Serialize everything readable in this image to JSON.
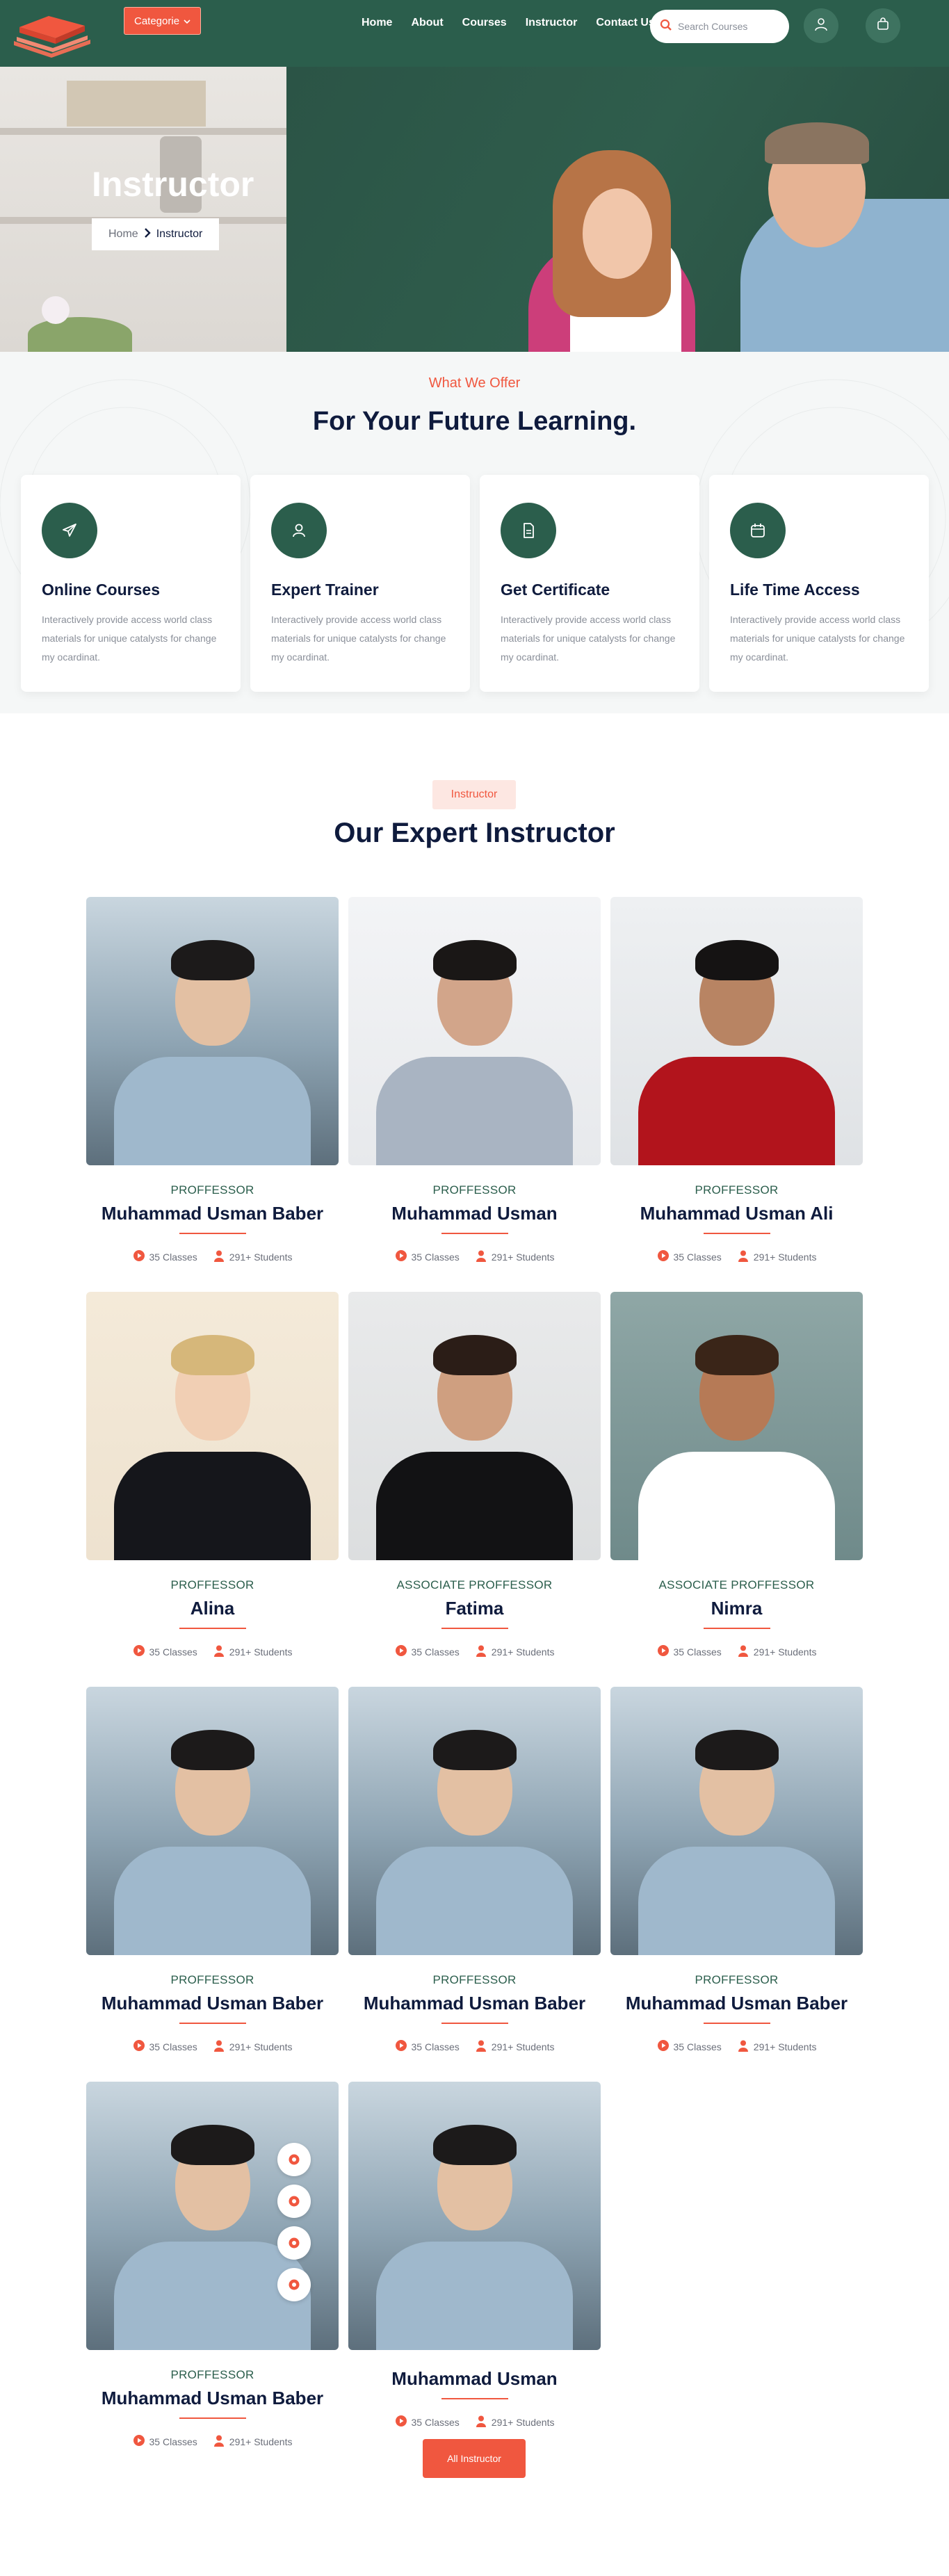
{
  "header": {
    "categorie_label": "Categorie",
    "nav": [
      "Home",
      "About",
      "Courses",
      "Instructor",
      "Contact Us"
    ],
    "search_placeholder": "Search Courses"
  },
  "hero": {
    "title": "Instructor",
    "breadcrumb_home": "Home",
    "breadcrumb_current": "Instructor"
  },
  "offer": {
    "subtitle": "What We Offer",
    "title": "For Your Future Learning.",
    "cards": [
      {
        "icon": "paper-plane-icon",
        "title": "Online Courses",
        "desc": "Interactively provide access world class materials for unique catalysts for change my ocardinat."
      },
      {
        "icon": "user-icon",
        "title": "Expert Trainer",
        "desc": "Interactively provide access world class materials for unique catalysts for change my ocardinat."
      },
      {
        "icon": "certificate-icon",
        "title": "Get Certificate",
        "desc": "Interactively provide access world class materials for unique catalysts for change my ocardinat."
      },
      {
        "icon": "calendar-icon",
        "title": "Life Time Access",
        "desc": "Interactively provide access world class materials for unique catalysts for change my ocardinat."
      }
    ]
  },
  "instructors": {
    "badge": "Instructor",
    "title": "Our Expert Instructor",
    "button": "All Instructor",
    "items": [
      {
        "role": "PROFFESSOR",
        "name": "Muhammad Usman Baber",
        "classes": "35 Classes",
        "students": "291+ Students"
      },
      {
        "role": "PROFFESSOR",
        "name": "Muhammad Usman",
        "classes": "35 Classes",
        "students": "291+ Students"
      },
      {
        "role": "PROFFESSOR",
        "name": "Muhammad Usman Ali",
        "classes": "35 Classes",
        "students": "291+ Students"
      },
      {
        "role": "PROFFESSOR",
        "name": "Alina",
        "classes": "35 Classes",
        "students": "291+ Students"
      },
      {
        "role": "ASSOCIATE PROFFESSOR",
        "name": "Fatima",
        "classes": "35 Classes",
        "students": "291+ Students"
      },
      {
        "role": "ASSOCIATE PROFFESSOR",
        "name": "Nimra",
        "classes": "35 Classes",
        "students": "291+ Students"
      },
      {
        "role": "PROFFESSOR",
        "name": "Muhammad Usman Baber",
        "classes": "35 Classes",
        "students": "291+ Students"
      },
      {
        "role": "PROFFESSOR",
        "name": "Muhammad Usman Baber",
        "classes": "35 Classes",
        "students": "291+ Students"
      },
      {
        "role": "PROFFESSOR",
        "name": "Muhammad Usman Baber",
        "classes": "35 Classes",
        "students": "291+ Students"
      },
      {
        "role": "PROFFESSOR",
        "name": "Muhammad Usman Baber",
        "classes": "35 Classes",
        "students": "291+ Students"
      },
      {
        "role": "",
        "name": "Muhammad Usman",
        "classes": "35 Classes",
        "students": "291+ Students"
      }
    ],
    "social_icons": [
      "facebook-icon",
      "twitter-icon",
      "instagram-icon",
      "youtube-icon"
    ]
  },
  "colors": {
    "primary_green": "#2b5e4c",
    "accent_orange": "#f0573f",
    "navy": "#0f1b3d"
  }
}
